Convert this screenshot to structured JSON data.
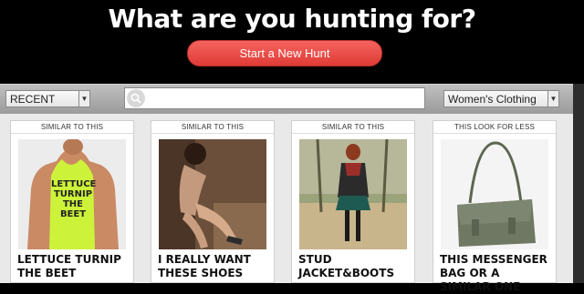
{
  "hero": {
    "title": "What are you hunting for?",
    "cta_label": "Start a New Hunt"
  },
  "toolbar": {
    "sort_selected": "RECENT",
    "search_placeholder": "",
    "category_selected": "Women's Clothing"
  },
  "cards": [
    {
      "label": "SIMILAR TO THIS",
      "title": "LETTUCE TURNIP THE BEET",
      "shirt_text": "LETTUCE TURNIP THE BEET",
      "image": "tank-top-photo"
    },
    {
      "label": "SIMILAR TO THIS",
      "title": "I REALLY WANT THESE SHOES",
      "image": "shoes-photo"
    },
    {
      "label": "SIMILAR TO THIS",
      "title": "STUD JACKET&BOOTS",
      "image": "jacket-boots-photo"
    },
    {
      "label": "THIS LOOK FOR LESS",
      "title": "THIS MESSENGER BAG OR A SIMILAR ONE",
      "image": "messenger-bag-photo"
    }
  ],
  "colors": {
    "cta": "#e8453f",
    "toolbar": "#a9a9a9",
    "background": "#000000"
  }
}
